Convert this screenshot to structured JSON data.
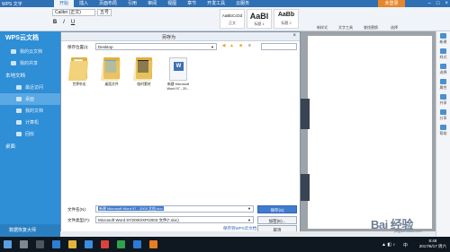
{
  "titlebar": {
    "app": "WPS 文字",
    "menu": [
      "开始",
      "插入",
      "页面布局",
      "引用",
      "审阅",
      "视图",
      "章节",
      "开发工具",
      "云服务"
    ],
    "active_menu_index": 0,
    "login": "未登录",
    "controls": [
      "–",
      "□",
      "×"
    ]
  },
  "ribbon": {
    "font": "Calibri (正文)",
    "size": "五号",
    "styles": [
      {
        "sample": "AaBbCcDd",
        "label": "正文"
      },
      {
        "sample": "AaBl",
        "label": "标题 1"
      },
      {
        "sample": "AaBb",
        "label": "标题 2"
      }
    ],
    "groups": [
      "新样式",
      "文字工具",
      "查找替换",
      "选择"
    ]
  },
  "cloud": {
    "title": "WPS云文档",
    "items_top": [
      "我的云文档",
      "我的共享"
    ],
    "local_title": "本地文档",
    "items_local": [
      "最近访问",
      "桌面",
      "我的文档",
      "计算机",
      "回收"
    ],
    "selected_index": 1,
    "extra": "桌面",
    "footer": "数据恢复大师"
  },
  "dialog": {
    "title": "另存为",
    "location_label": "保存位置(I):",
    "location_value": "Desktop",
    "files": [
      {
        "name": "世界杂志"
      },
      {
        "name": "桌面文件"
      },
      {
        "name": "临时素材"
      },
      {
        "name": "新建 Microsoft Word 97 - 20..."
      }
    ],
    "filename_label": "文件名(N):",
    "filename_value": "新建 Microsoft Word 97 - 2003 文档.doc",
    "filetype_label": "文件类型(T):",
    "filetype_value": "Microsoft Word 97/2000/XP/2003 文件(*.doc)",
    "save_button": "保存(S)",
    "encrypt_button": "加密(E)...",
    "cancel_button": "取消",
    "link": "保存到WPS云文档"
  },
  "rightbar": [
    "新建",
    "样式",
    "选择",
    "属性",
    "共享",
    "分享",
    "帮助"
  ],
  "watermark": {
    "main": "Bai 经验",
    "sub": "jingyan.baidu.com"
  },
  "taskbar": {
    "time": "8:48",
    "date": "2017/6/17 周六",
    "lang": "中"
  }
}
